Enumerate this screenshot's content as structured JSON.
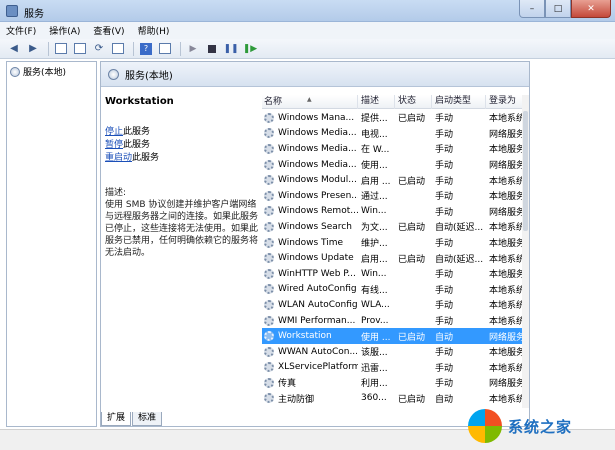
{
  "window": {
    "title": "服务"
  },
  "menu": [
    "文件(F)",
    "操作(A)",
    "查看(V)",
    "帮助(H)"
  ],
  "tree": {
    "root": "服务(本地)"
  },
  "main": {
    "header": "服务(本地)",
    "service_title": "Workstation",
    "links": [
      {
        "link": "停止",
        "rest": "此服务"
      },
      {
        "link": "暂停",
        "rest": "此服务"
      },
      {
        "link": "重启动",
        "rest": "此服务"
      }
    ],
    "description": "描述:\n使用 SMB 协议创建并维护客户端网络与远程服务器之间的连接。如果此服务已停止，这些连接将无法使用。如果此服务已禁用，任何明确依赖它的服务将无法启动。"
  },
  "columns": [
    "名称",
    "描述",
    "状态",
    "启动类型",
    "登录为"
  ],
  "rows": [
    {
      "name": "Windows Mana...",
      "desc": "提供...",
      "status": "已启动",
      "start": "手动",
      "logon": "本地系统"
    },
    {
      "name": "Windows Media...",
      "desc": "电视...",
      "status": "",
      "start": "手动",
      "logon": "网络服务"
    },
    {
      "name": "Windows Media...",
      "desc": "在 W...",
      "status": "",
      "start": "手动",
      "logon": "本地服务"
    },
    {
      "name": "Windows Media...",
      "desc": "使用...",
      "status": "",
      "start": "手动",
      "logon": "网络服务"
    },
    {
      "name": "Windows Modul...",
      "desc": "启用 ...",
      "status": "已启动",
      "start": "手动",
      "logon": "本地系统"
    },
    {
      "name": "Windows Presen...",
      "desc": "通过...",
      "status": "",
      "start": "手动",
      "logon": "本地服务"
    },
    {
      "name": "Windows Remot...",
      "desc": "Win...",
      "status": "",
      "start": "手动",
      "logon": "网络服务"
    },
    {
      "name": "Windows Search",
      "desc": "为文...",
      "status": "已启动",
      "start": "自动(延迟...",
      "logon": "本地系统"
    },
    {
      "name": "Windows Time",
      "desc": "维护...",
      "status": "",
      "start": "手动",
      "logon": "本地服务"
    },
    {
      "name": "Windows Update",
      "desc": "启用...",
      "status": "已启动",
      "start": "自动(延迟...",
      "logon": "本地系统"
    },
    {
      "name": "WinHTTP Web P...",
      "desc": "Win...",
      "status": "",
      "start": "手动",
      "logon": "本地服务"
    },
    {
      "name": "Wired AutoConfig",
      "desc": "有线...",
      "status": "",
      "start": "手动",
      "logon": "本地系统"
    },
    {
      "name": "WLAN AutoConfig",
      "desc": "WLA...",
      "status": "",
      "start": "手动",
      "logon": "本地系统"
    },
    {
      "name": "WMI Performan...",
      "desc": "Prov...",
      "status": "",
      "start": "手动",
      "logon": "本地系统"
    },
    {
      "name": "Workstation",
      "desc": "使用 ...",
      "status": "已启动",
      "start": "自动",
      "logon": "网络服务",
      "selected": true
    },
    {
      "name": "WWAN AutoCon...",
      "desc": "该服...",
      "status": "",
      "start": "手动",
      "logon": "本地服务"
    },
    {
      "name": "XLServicePlatform",
      "desc": "迅雷...",
      "status": "",
      "start": "手动",
      "logon": "本地系统"
    },
    {
      "name": "传真",
      "desc": "利用...",
      "status": "",
      "start": "手动",
      "logon": "网络服务"
    },
    {
      "name": "主动防御",
      "desc": "360...",
      "status": "已启动",
      "start": "自动",
      "logon": "本地系统"
    }
  ],
  "tabs": [
    "扩展",
    "标准"
  ],
  "watermark": {
    "text": "系统之家"
  },
  "icons": [
    "app-icon",
    "back-arrow-icon",
    "forward-arrow-icon",
    "console-tree-icon",
    "properties-icon",
    "refresh-icon",
    "export-list-icon",
    "help-icon",
    "show-hide-icon",
    "start-service-icon",
    "stop-service-icon",
    "pause-service-icon",
    "restart-service-icon",
    "gear-icon"
  ]
}
